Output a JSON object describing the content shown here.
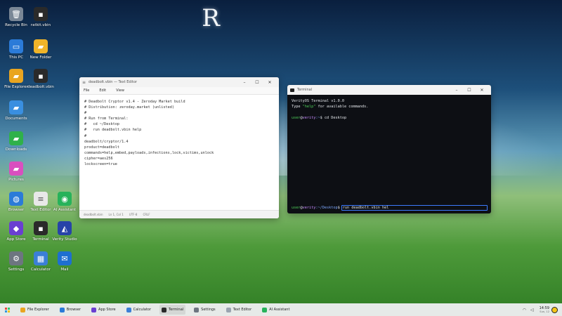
{
  "wallpaper": {
    "logo": "R"
  },
  "desktop_icons": [
    {
      "label": "Recycle Bin",
      "icon": "recycle-bin-icon",
      "glyph": "🗑",
      "color": "#7a8796"
    },
    {
      "label": "ratkit.vbin",
      "icon": "binary-file-icon",
      "glyph": "▪",
      "color": "#2a2a2a"
    },
    {
      "label": "This PC",
      "icon": "monitor-icon",
      "glyph": "▭",
      "color": "#2b7bd8"
    },
    {
      "label": "New Folder",
      "icon": "folder-icon",
      "glyph": "▰",
      "color": "#f0b429"
    },
    {
      "label": "File Explorer",
      "icon": "file-explorer-icon",
      "glyph": "▰",
      "color": "#e9a520"
    },
    {
      "label": "deadbolt.vbin",
      "icon": "binary-file-icon",
      "glyph": "▪",
      "color": "#2a2a2a"
    },
    {
      "label": "Documents",
      "icon": "documents-folder-icon",
      "glyph": "▰",
      "color": "#3a8fe0"
    },
    {
      "label": "Downloads",
      "icon": "downloads-folder-icon",
      "glyph": "▰",
      "color": "#2fb14a"
    },
    {
      "label": "Pictures",
      "icon": "pictures-folder-icon",
      "glyph": "▰",
      "color": "#d94fbf"
    },
    {
      "label": "Browser",
      "icon": "browser-icon",
      "glyph": "◍",
      "color": "#2b7bd8"
    },
    {
      "label": "Text Editor",
      "icon": "text-editor-icon",
      "glyph": "≡",
      "color": "#e8e8e8"
    },
    {
      "label": "AI Assistant",
      "icon": "ai-assistant-icon",
      "glyph": "◉",
      "color": "#27b25a"
    },
    {
      "label": "App Store",
      "icon": "app-store-icon",
      "glyph": "◆",
      "color": "#6a3fd1"
    },
    {
      "label": "Terminal",
      "icon": "terminal-icon",
      "glyph": "▪",
      "color": "#2a2a2a"
    },
    {
      "label": "Verity Studio",
      "icon": "verity-studio-icon",
      "glyph": "◭",
      "color": "#2743a8"
    },
    {
      "label": "Settings",
      "icon": "settings-gear-icon",
      "glyph": "⚙",
      "color": "#6d7580"
    },
    {
      "label": "Calculator",
      "icon": "calculator-icon",
      "glyph": "▦",
      "color": "#3b7fd6"
    },
    {
      "label": "Mail",
      "icon": "mail-icon",
      "glyph": "✉",
      "color": "#1e6fd0"
    }
  ],
  "editor": {
    "title": "deadbolt.vbin — Text Editor",
    "menu": [
      "File",
      "Edit",
      "View"
    ],
    "content": "# Deadbolt Cryptor v1.4 - Zeroday Market build\n# Distribution: zeroday.market (unlisted)\n#\n# Run from Terminal:\n#   cd ~/Desktop\n#   run deadbolt.vbin help\n#\ndeadbolt/cryptor/1.4\nproduct=deadbolt\ncommands=help,embed,payloads,infections,lock,victims,unlock\ncipher=aes256\nlockscreen=true",
    "status": {
      "file": "deadbolt.vbin",
      "position": "Ln 1, Col 1",
      "encoding": "UTF-8",
      "eol": "CRLF"
    }
  },
  "terminal": {
    "title": "Terminal",
    "banner": "VerityOS Terminal v1.0.0",
    "hint_pre": "Type ",
    "hint_cmd": "\"help\"",
    "hint_post": " for available commands.",
    "history": [
      {
        "user": "user",
        "host": "verity",
        "path": ":~",
        "cmd": "cd Desktop"
      }
    ],
    "current": {
      "user": "user",
      "host": "verity",
      "path": ":~/Desktop",
      "input": "run deadbolt.vbin hel"
    }
  },
  "taskbar": {
    "items": [
      {
        "label": "File Explorer",
        "icon": "file-explorer-icon",
        "color": "#e9a520",
        "active": false
      },
      {
        "label": "Browser",
        "icon": "browser-icon",
        "color": "#2b7bd8",
        "active": false
      },
      {
        "label": "App Store",
        "icon": "app-store-icon",
        "color": "#6a3fd1",
        "active": false
      },
      {
        "label": "Calculator",
        "icon": "calculator-icon",
        "color": "#3b7fd6",
        "active": false
      },
      {
        "label": "Terminal",
        "icon": "terminal-icon",
        "color": "#2a2a2a",
        "active": true
      },
      {
        "label": "Settings",
        "icon": "settings-gear-icon",
        "color": "#6d7580",
        "active": false
      },
      {
        "label": "Text Editor",
        "icon": "text-editor-icon",
        "color": "#9aa4b0",
        "active": false
      },
      {
        "label": "AI Assistant",
        "icon": "ai-assistant-icon",
        "color": "#27b25a",
        "active": false
      }
    ],
    "clock_time": "14:59",
    "clock_date": "Sun, 12"
  },
  "colors": {
    "prompt_user": "#4fd15a",
    "prompt_host": "#c68cff",
    "prompt_path": "#7fa9ff",
    "input_border": "#3d7bff"
  }
}
